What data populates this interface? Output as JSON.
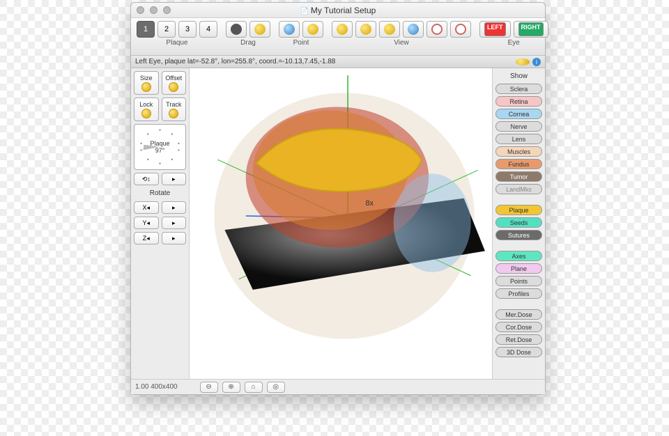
{
  "window": {
    "title": "My Tutorial Setup"
  },
  "toolbar": {
    "plaque": {
      "label": "Plaque",
      "items": [
        "1",
        "2",
        "3",
        "4"
      ],
      "selected": 0
    },
    "drag": {
      "label": "Drag"
    },
    "point": {
      "label": "Point"
    },
    "view": {
      "label": "View"
    },
    "eye": {
      "label": "Eye",
      "left": "LEFT",
      "right": "RIGHT"
    }
  },
  "status": {
    "text": "Left Eye, plaque lat=-52.8°, lon=255.8°, coord.=-10.13,7.45,-1.88"
  },
  "left": {
    "size": "Size",
    "offset": "Offset",
    "lock": "Lock",
    "track": "Track",
    "compass_label": "Plaque",
    "compass_angle": "97°",
    "rotate_header": "Rotate",
    "axes": [
      "X",
      "Y",
      "Z"
    ],
    "left_arrow": "◂",
    "right_arrow": "▸"
  },
  "show": {
    "header": "Show",
    "items": [
      {
        "label": "Sclera",
        "bg": "#dcdcdc"
      },
      {
        "label": "Retina",
        "bg": "#f6c6c6"
      },
      {
        "label": "Cornea",
        "bg": "#a9d6f0"
      },
      {
        "label": "Nerve",
        "bg": "#dcdcdc"
      },
      {
        "label": "Lens",
        "bg": "#dcdcdc"
      },
      {
        "label": "Muscles",
        "bg": "#f4d6ba"
      },
      {
        "label": "Fundus",
        "bg": "#e89a6c"
      },
      {
        "label": "Tumor",
        "bg": "#8d7a6a",
        "fg": "#fff"
      },
      {
        "label": "LandMks",
        "bg": "#dcdcdc",
        "fg": "#888"
      }
    ],
    "items2": [
      {
        "label": "Plaque",
        "bg": "#f2c632"
      },
      {
        "label": "Seeds",
        "bg": "#53e0c1"
      },
      {
        "label": "Sutures",
        "bg": "#6b6b6b",
        "fg": "#fff"
      }
    ],
    "items3": [
      {
        "label": "Axes",
        "bg": "#5fe6c0"
      },
      {
        "label": "Plane",
        "bg": "#f2c9ef"
      },
      {
        "label": "Points",
        "bg": "#dcdcdc"
      },
      {
        "label": "Profiles",
        "bg": "#dcdcdc"
      }
    ],
    "items4": [
      {
        "label": "Mer.Dose",
        "bg": "#dcdcdc"
      },
      {
        "label": "Cor.Dose",
        "bg": "#dcdcdc"
      },
      {
        "label": "Ret.Dose",
        "bg": "#dcdcdc"
      },
      {
        "label": "3D Dose",
        "bg": "#dcdcdc"
      }
    ]
  },
  "footer": {
    "zoom": "1.00 400x400",
    "btns": [
      "⊖",
      "⊕",
      "⌂",
      "◎"
    ]
  }
}
